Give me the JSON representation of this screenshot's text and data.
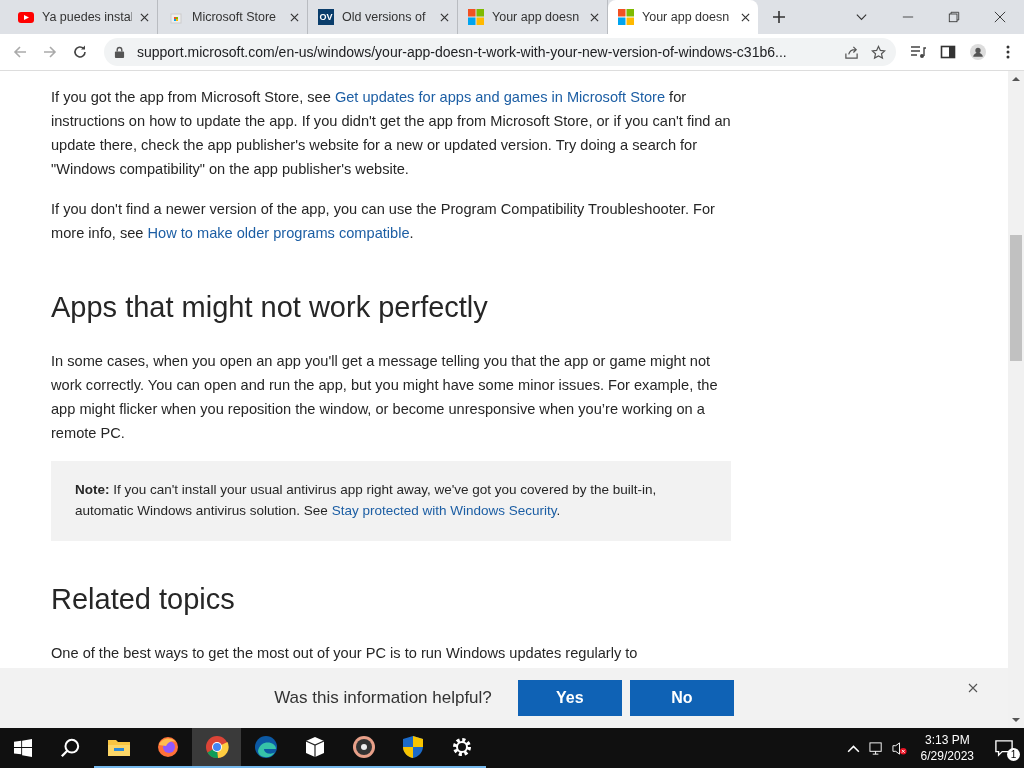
{
  "tabs": [
    {
      "title": "Ya puedes instal",
      "kind": "youtube",
      "selected": false
    },
    {
      "title": "Microsoft Store",
      "kind": "store",
      "selected": false
    },
    {
      "title": "Old versions of",
      "kind": "ov",
      "favicon_text": "OV",
      "selected": false
    },
    {
      "title": "Your app doesn",
      "kind": "microsoft",
      "selected": false
    },
    {
      "title": "Your app doesn",
      "kind": "microsoft",
      "selected": true
    }
  ],
  "address_bar": {
    "url": "support.microsoft.com/en-us/windows/your-app-doesn-t-work-with-your-new-version-of-windows-c31b6..."
  },
  "content": [
    {
      "kind": "paragraph",
      "parts": [
        {
          "kind": "text",
          "text": "If you got the app from Microsoft Store, see "
        },
        {
          "kind": "link",
          "text": "Get updates for apps and games in Microsoft Store"
        },
        {
          "kind": "text",
          "text": " for instructions on how to update the app. If you didn't get the app from Microsoft Store, or if you can't find an update there, check the app publisher's website for a new or updated version. Try doing a search for \"Windows compatibility\" on the app publisher's website."
        }
      ]
    },
    {
      "kind": "paragraph",
      "parts": [
        {
          "kind": "text",
          "text": "If you don't find a newer version of the app, you can use the Program Compatibility Troubleshooter. For more info, see "
        },
        {
          "kind": "link",
          "text": "How to make older programs compatible"
        },
        {
          "kind": "text",
          "text": "."
        }
      ]
    },
    {
      "kind": "heading",
      "text": "Apps that might not work perfectly"
    },
    {
      "kind": "paragraph",
      "parts": [
        {
          "kind": "text",
          "text": "In some cases, when you open an app you'll get a message telling you that the app or game might not work correctly. You can open and run the app, but you might have some minor issues. For example, the app might flicker when you reposition the window, or become unresponsive when you’re working on a remote PC."
        }
      ]
    },
    {
      "kind": "note",
      "label": "Note:",
      "parts": [
        {
          "kind": "text",
          "text": " If you can't install your usual antivirus app right away, we've got you covered by the built-in, automatic Windows antivirus solution. See "
        },
        {
          "kind": "link",
          "text": "Stay protected with Windows Security"
        },
        {
          "kind": "text",
          "text": "."
        }
      ]
    },
    {
      "kind": "heading",
      "text": "Related topics"
    },
    {
      "kind": "paragraph",
      "parts": [
        {
          "kind": "text",
          "text": "One of the best ways to get the most out of your PC is to run Windows updates regularly to"
        }
      ]
    }
  ],
  "feedback": {
    "question": "Was this information helpful?",
    "buttons": [
      "Yes",
      "No"
    ]
  },
  "taskbar": {
    "apps": [
      {
        "kind": "explorer",
        "selected": false
      },
      {
        "kind": "firefox",
        "selected": false
      },
      {
        "kind": "chrome",
        "selected": true
      },
      {
        "kind": "edge",
        "selected": false
      },
      {
        "kind": "package",
        "selected": false
      },
      {
        "kind": "media",
        "selected": false
      },
      {
        "kind": "shield",
        "selected": false
      },
      {
        "kind": "settings",
        "selected": false
      }
    ],
    "time": "3:13 PM",
    "date": "6/29/2023",
    "notification_count": "1"
  }
}
